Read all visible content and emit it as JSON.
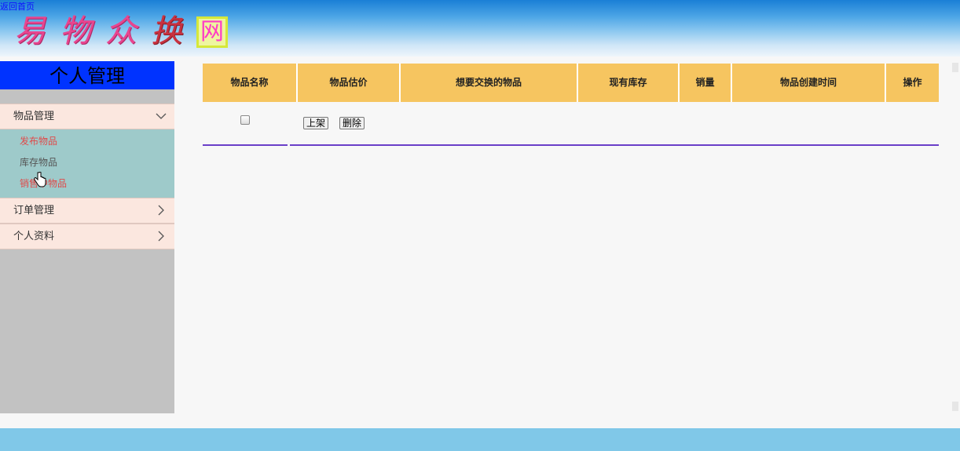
{
  "header": {
    "back_link": "返回首页",
    "logo_chars": [
      "易",
      "物",
      "众",
      "换",
      "网"
    ]
  },
  "sidebar": {
    "title": "个人管理",
    "groups": [
      {
        "label": "物品管理",
        "expanded": true,
        "items": [
          {
            "label": "发布物品",
            "state": "active"
          },
          {
            "label": "库存物品",
            "state": "normal"
          },
          {
            "label": "销售中物品",
            "state": "active"
          }
        ]
      },
      {
        "label": "订单管理",
        "expanded": false
      },
      {
        "label": "个人资料",
        "expanded": false
      }
    ]
  },
  "table": {
    "columns": [
      "物品名称",
      "物品估价",
      "想要交换的物品",
      "现有库存",
      "销量",
      "物品创建时间",
      "操作"
    ],
    "row": {
      "shelve_label": "上架",
      "delete_label": "删除"
    }
  },
  "colors": {
    "header_top": "#1a7fd6",
    "sidebar_title_bg": "#0033ff",
    "sidebar_bg": "#c2c2c2",
    "menu_header_bg": "#fbe7df",
    "submenu_bg": "#9ecaca",
    "table_header_bg": "#f6c560",
    "row_line": "#6a3fc8",
    "footer_bg": "#80c8e8"
  }
}
